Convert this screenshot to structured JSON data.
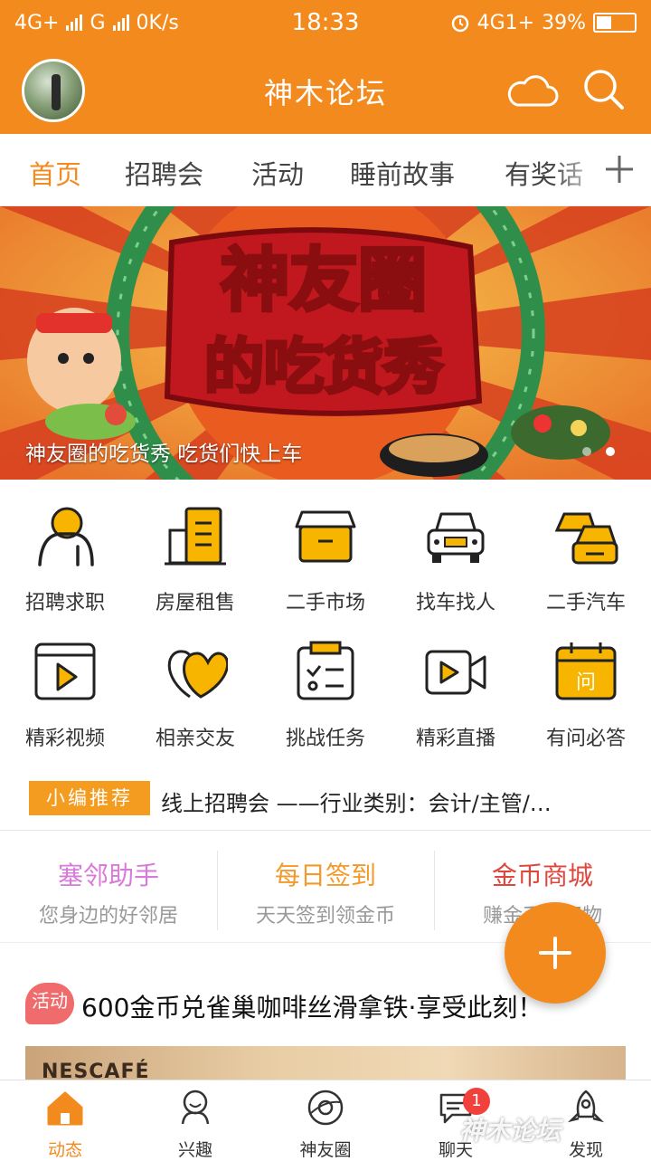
{
  "status_bar": {
    "left_text": "4G+",
    "net2": "G",
    "speed": "0K/s",
    "time": "18:33",
    "net_right": "4G1+",
    "battery": "39%",
    "battery_level": 0.39
  },
  "app_bar": {
    "title": "神木论坛",
    "icons": [
      "cloud-icon",
      "search-icon"
    ]
  },
  "tabs": {
    "items": [
      "首页",
      "招聘会",
      "活动",
      "睡前故事",
      "有奖话"
    ],
    "active_index": 0
  },
  "banner": {
    "caption": "神友圈的吃货秀 吃货们快上车",
    "art_title_line1": "神友圈",
    "art_title_line2": "的吃货秀",
    "active_dot": 1,
    "dot_count": 2
  },
  "grid": {
    "items": [
      {
        "label": "招聘求职",
        "icon": "person-icon"
      },
      {
        "label": "房屋租售",
        "icon": "building-icon"
      },
      {
        "label": "二手市场",
        "icon": "shop-icon"
      },
      {
        "label": "找车找人",
        "icon": "car-icon"
      },
      {
        "label": "二手汽车",
        "icon": "cars-icon"
      },
      {
        "label": "精彩视频",
        "icon": "video-icon"
      },
      {
        "label": "相亲交友",
        "icon": "hearts-icon"
      },
      {
        "label": "挑战任务",
        "icon": "task-icon"
      },
      {
        "label": "精彩直播",
        "icon": "live-camera-icon"
      },
      {
        "label": "有问必答",
        "icon": "calendar-question-icon",
        "glyph": "问"
      }
    ]
  },
  "recommend": {
    "badge": "小编推荐",
    "text": "线上招聘会 ——行业类别：会计/主管/…"
  },
  "features": [
    {
      "title": "塞邻助手",
      "subtitle": "您身边的好邻居",
      "color": "#d77ad9"
    },
    {
      "title": "每日签到",
      "subtitle": "天天签到领金币",
      "color": "#f39a2a"
    },
    {
      "title": "金币商城",
      "subtitle": "赚金币兑好物",
      "color": "#e0473c"
    }
  ],
  "post": {
    "tag": "活动",
    "title": "600金币兑雀巢咖啡丝滑拿铁·享受此刻！",
    "image_brand": "NESCAFÉ"
  },
  "bottom_nav": {
    "items": [
      {
        "label": "动态",
        "icon": "home-icon"
      },
      {
        "label": "兴趣",
        "icon": "interest-icon"
      },
      {
        "label": "神友圈",
        "icon": "planet-icon"
      },
      {
        "label": "聊天",
        "icon": "chat-icon",
        "badge": "1"
      },
      {
        "label": "发现",
        "icon": "rocket-icon"
      }
    ],
    "active_index": 0
  },
  "watermark": "神木论坛"
}
